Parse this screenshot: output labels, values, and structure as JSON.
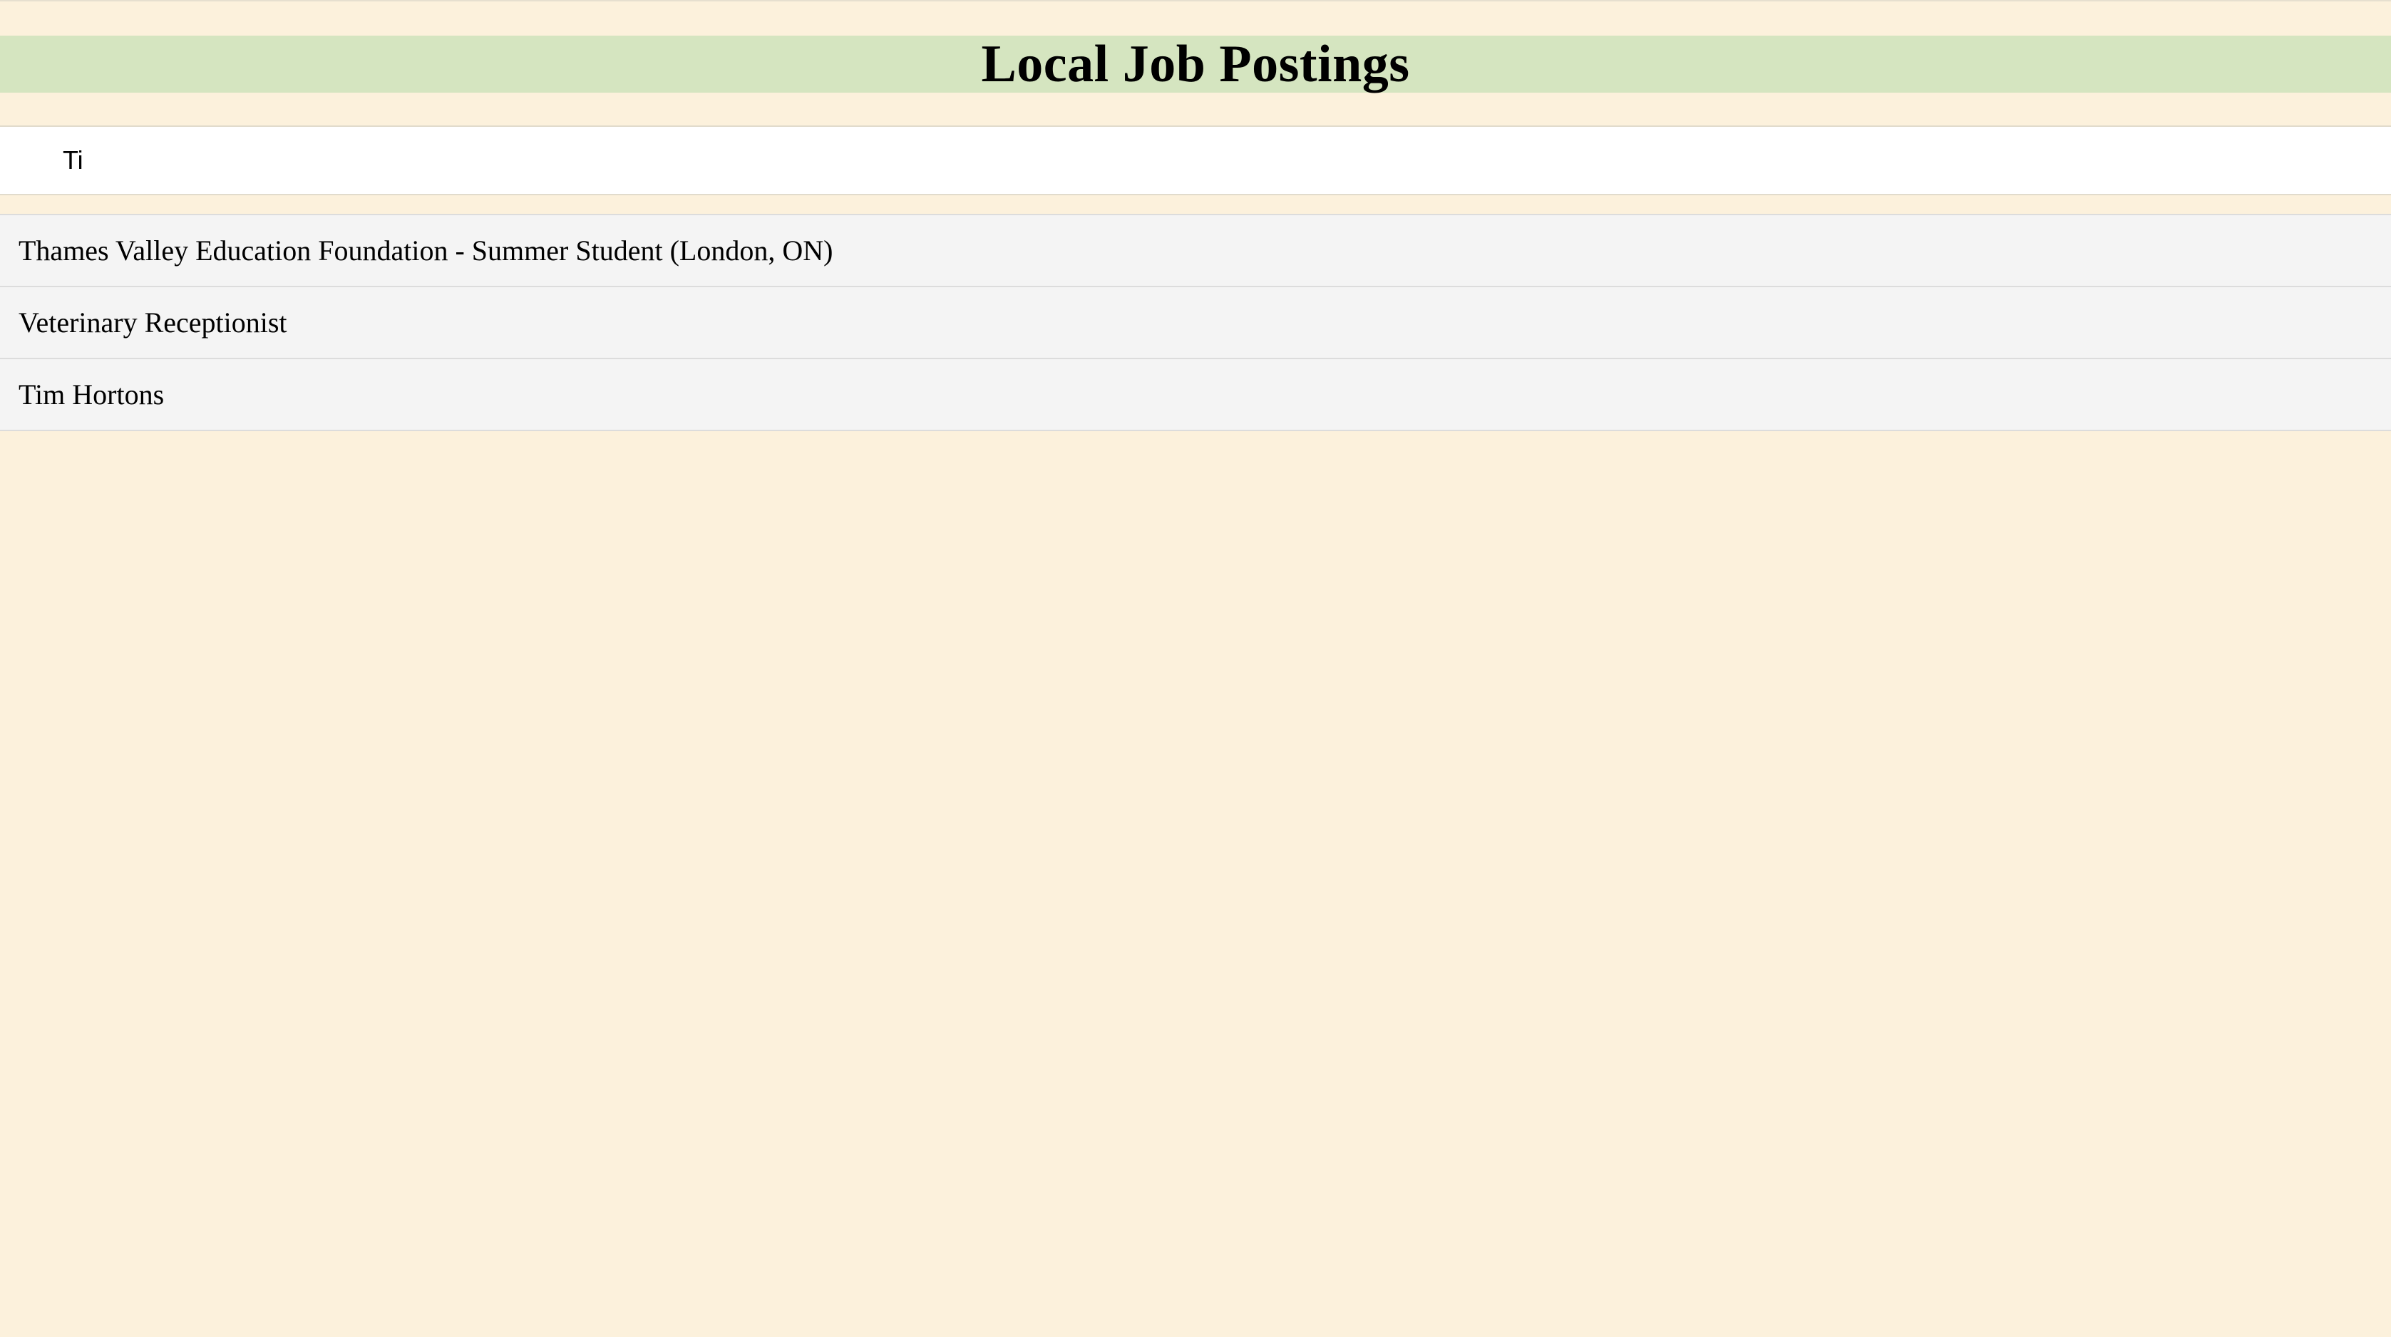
{
  "header": {
    "title": "Local Job Postings"
  },
  "search": {
    "value": "Ti"
  },
  "results": [
    {
      "label": "Thames Valley Education Foundation - Summer Student (London, ON)"
    },
    {
      "label": "Veterinary Receptionist"
    },
    {
      "label": "Tim Hortons"
    }
  ],
  "colors": {
    "background": "#fcf1dc",
    "header_background": "#d5e5c0",
    "result_background": "#f4f4f4"
  }
}
